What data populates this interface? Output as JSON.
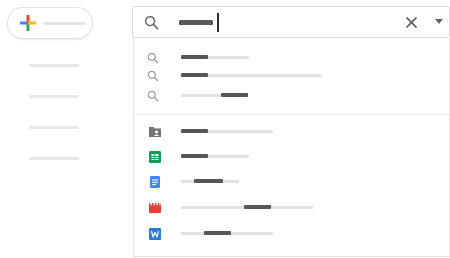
{
  "new_button": {
    "icon": "plus-icon",
    "colors": [
      "#4285f4",
      "#ea4335",
      "#fbbc05",
      "#34a853"
    ]
  },
  "left_nav": {
    "item_count": 4
  },
  "search": {
    "icon": "search-icon",
    "clear_icon": "close-icon",
    "options_icon": "caret-down-icon"
  },
  "suggestions": {
    "query_items": [
      {
        "icon": "search-icon"
      },
      {
        "icon": "search-icon"
      },
      {
        "icon": "search-icon"
      }
    ],
    "file_items": [
      {
        "icon": "shared-folder-icon",
        "color": "#757575"
      },
      {
        "icon": "sheets-icon",
        "color": "#0f9d58"
      },
      {
        "icon": "docs-icon",
        "color": "#4285f4"
      },
      {
        "icon": "video-icon",
        "color": "#db4437"
      },
      {
        "icon": "word-icon",
        "color": "#2b7cd3"
      }
    ]
  }
}
